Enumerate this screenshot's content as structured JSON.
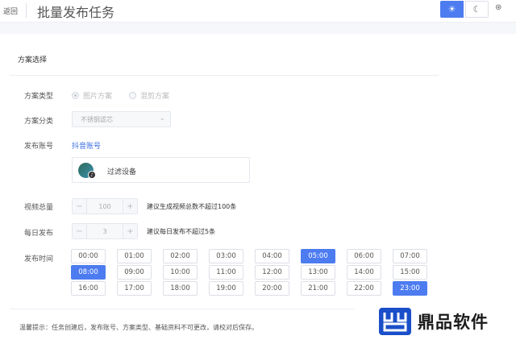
{
  "header": {
    "back_label": "返回",
    "title": "批量发布任务",
    "theme_light_icon": "sun-icon",
    "theme_dark_icon": "moon-icon",
    "lang_icon": "translate-icon"
  },
  "section": {
    "title": "方案选择"
  },
  "form": {
    "scheme_type": {
      "label": "方案类型",
      "options": [
        "图片方案",
        "混剪方案"
      ],
      "selected": "图片方案"
    },
    "scheme_category": {
      "label": "方案分类",
      "value": "不锈钢滤芯"
    },
    "account": {
      "label": "发布账号",
      "platform_link": "抖音账号",
      "device_name": "过滤设备"
    },
    "video_total": {
      "label": "视频总量",
      "value": "100",
      "hint": "建议生成视频总数不超过100条"
    },
    "daily_publish": {
      "label": "每日发布",
      "value": "3",
      "hint": "建议每日发布不超过5条"
    },
    "publish_time": {
      "label": "发布时间",
      "slots": [
        "00:00",
        "01:00",
        "02:00",
        "03:00",
        "04:00",
        "05:00",
        "06:00",
        "07:00",
        "08:00",
        "09:00",
        "10:00",
        "11:00",
        "12:00",
        "13:00",
        "14:00",
        "15:00",
        "16:00",
        "17:00",
        "18:00",
        "19:00",
        "20:00",
        "21:00",
        "22:00",
        "23:00"
      ],
      "selected": [
        "05:00",
        "08:00",
        "23:00"
      ]
    }
  },
  "footer": {
    "tip": "温馨提示：任务创建后，发布账号、方案类型、基础资料不可更改，请校对后保存。"
  },
  "watermark": {
    "text": "鼎品软件"
  },
  "colors": {
    "accent": "#4d7cf0",
    "link": "#3a6de0"
  }
}
